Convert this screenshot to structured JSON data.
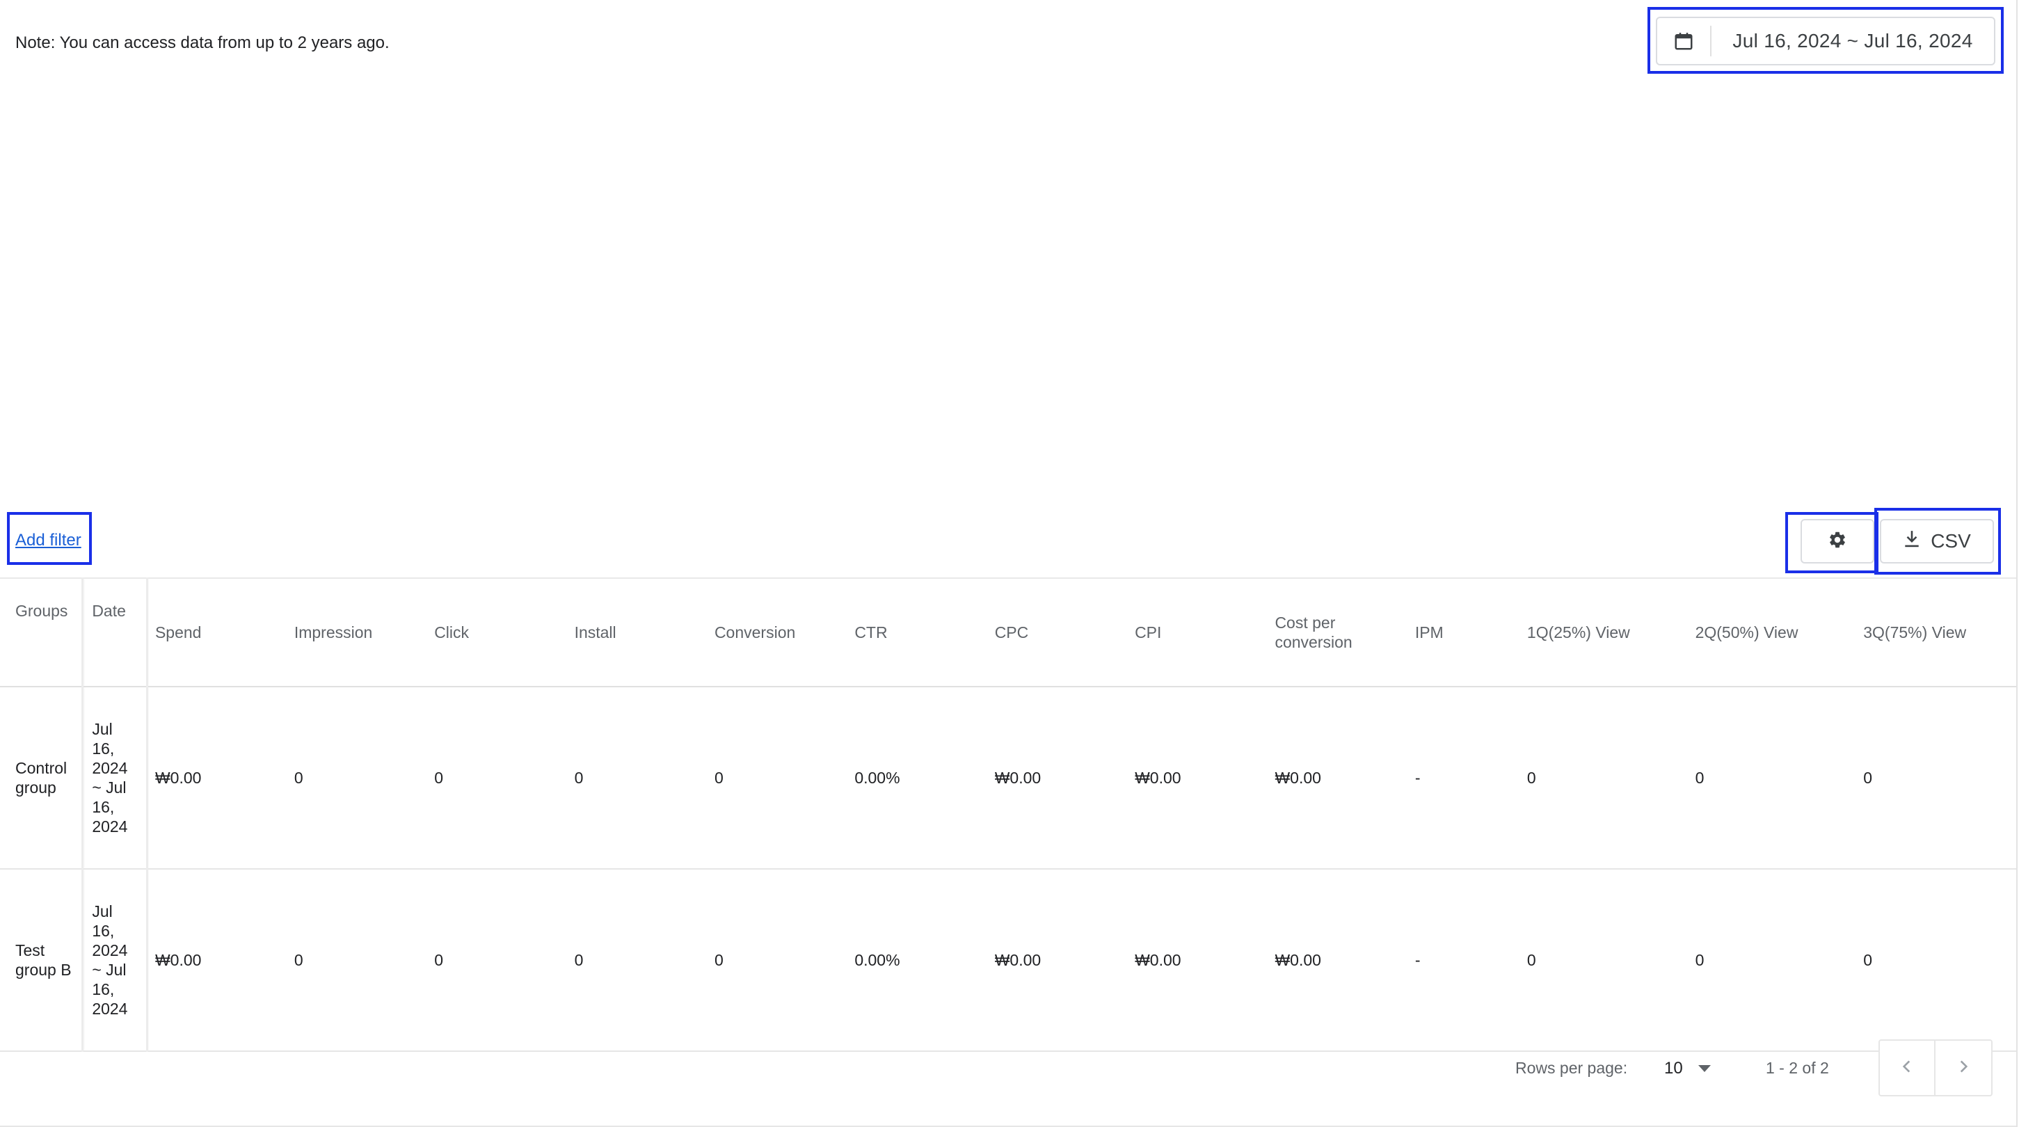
{
  "note": "Note: You can access data from up to 2 years ago.",
  "date_picker": {
    "icon": "calendar-icon",
    "range": "Jul 16, 2024 ~ Jul 16, 2024"
  },
  "toolbar": {
    "add_filter_label": "Add filter",
    "settings_icon": "gear-icon",
    "csv_icon": "download-icon",
    "csv_label": "CSV"
  },
  "highlight_color": "#1a2fe8",
  "table": {
    "columns": [
      "Groups",
      "Date",
      "Spend",
      "Impression",
      "Click",
      "Install",
      "Conversion",
      "CTR",
      "CPC",
      "CPI",
      "Cost per conversion",
      "IPM",
      "1Q(25%) View",
      "2Q(50%) View",
      "3Q(75%) View"
    ],
    "rows": [
      [
        "Control group",
        "Jul 16, 2024 ~ Jul 16, 2024",
        "₩0.00",
        "0",
        "0",
        "0",
        "0",
        "0.00%",
        "₩0.00",
        "₩0.00",
        "₩0.00",
        "-",
        "0",
        "0",
        "0"
      ],
      [
        "Test group B",
        "Jul 16, 2024 ~ Jul 16, 2024",
        "₩0.00",
        "0",
        "0",
        "0",
        "0",
        "0.00%",
        "₩0.00",
        "₩0.00",
        "₩0.00",
        "-",
        "0",
        "0",
        "0"
      ]
    ]
  },
  "pagination": {
    "rows_per_page_label": "Rows per page:",
    "rows_per_page_value": "10",
    "range_label": "1 - 2 of 2",
    "prev_icon": "chevron-left-icon",
    "next_icon": "chevron-right-icon"
  }
}
